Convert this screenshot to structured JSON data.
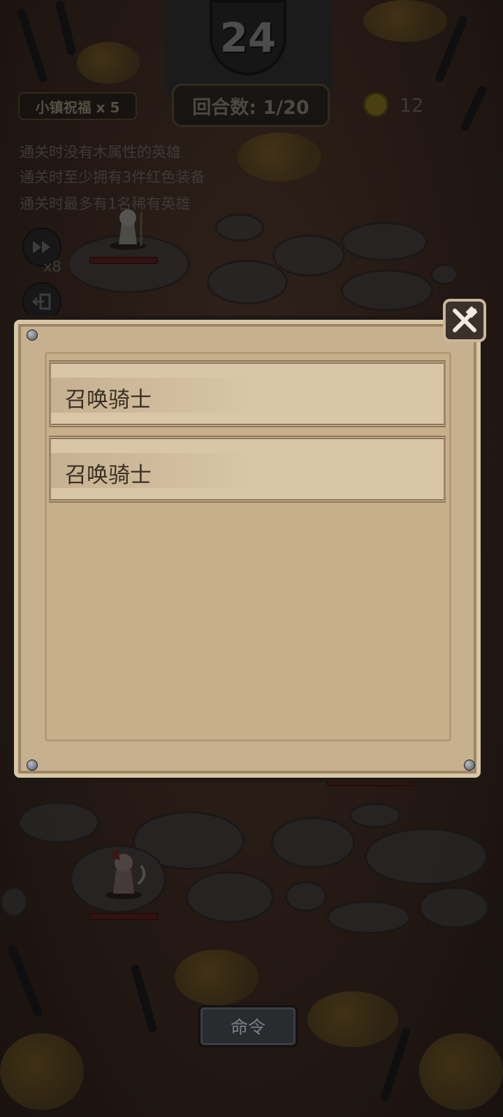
{
  "hud": {
    "turn_counter": "24",
    "blessing": "小镇祝福 x 5",
    "round": "回合数: 1/20",
    "coins": "12"
  },
  "objectives": [
    "通关时没有木属性的英雄",
    "通关时至少拥有3件红色装备",
    "通关时最多有1名稀有英雄"
  ],
  "controls": {
    "speed_label": "x8",
    "command_label": "命令"
  },
  "battle_log": {
    "entries": [
      "召唤骑士",
      "召唤骑士"
    ]
  },
  "colors": {
    "panel": "#c7b08e",
    "panel_border": "#1e1715",
    "text_dark": "#3b2f25"
  }
}
